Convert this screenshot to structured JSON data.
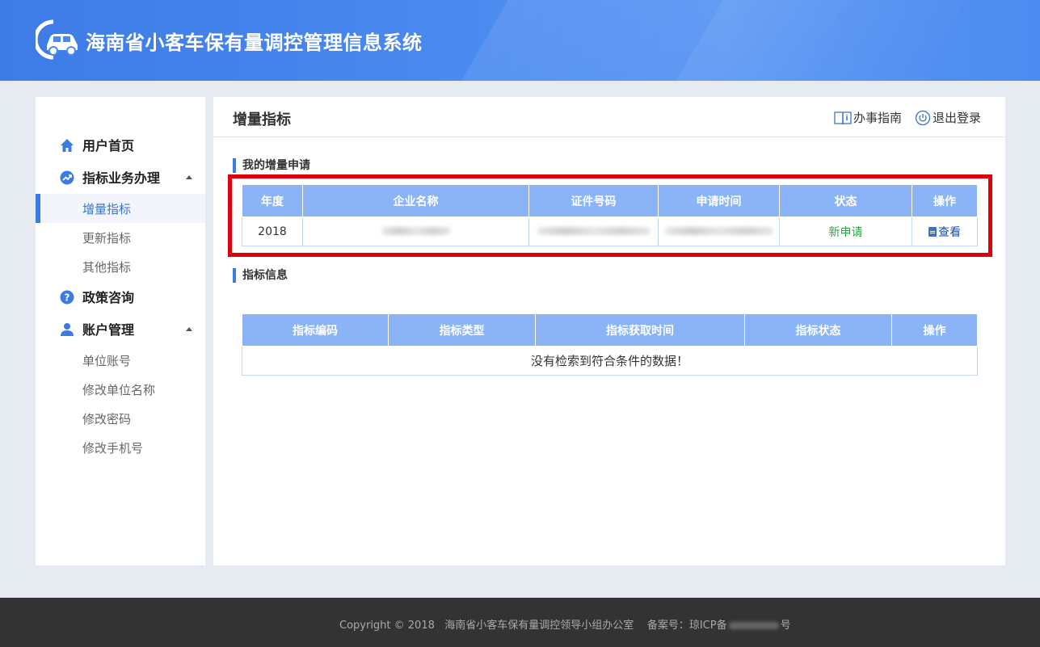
{
  "header": {
    "title": "海南省小客车保有量调控管理信息系统",
    "logo_icon": "car-logo-icon"
  },
  "sidebar": {
    "groups": [
      {
        "label": "用户首页",
        "icon": "home-icon"
      },
      {
        "label": "指标业务办理",
        "icon": "trend-icon"
      },
      {
        "label": "政策咨询",
        "icon": "question-icon"
      },
      {
        "label": "账户管理",
        "icon": "user-icon"
      }
    ],
    "sub_business": [
      "增量指标",
      "更新指标",
      "其他指标"
    ],
    "sub_account": [
      "单位账号",
      "修改单位名称",
      "修改密码",
      "修改手机号"
    ]
  },
  "main": {
    "page_title": "增量指标",
    "guide_link": "办事指南",
    "logout_link": "退出登录",
    "section1_title": "我的增量申请",
    "table1": {
      "headers": [
        "年度",
        "企业名称",
        "证件号码",
        "申请时间",
        "状态",
        "操作"
      ],
      "rows": [
        {
          "year": "2018",
          "status": "新申请",
          "action": "查看"
        }
      ]
    },
    "section2_title": "指标信息",
    "table2": {
      "headers": [
        "指标编码",
        "指标类型",
        "指标获取时间",
        "指标状态",
        "操作"
      ],
      "empty_message": "没有检索到符合条件的数据！"
    }
  },
  "footer": {
    "copyright": "Copyright © 2018",
    "org": "海南省小客车保有量调控领导小组办公室",
    "icp_prefix": "备案号：琼ICP备",
    "icp_suffix": "号"
  },
  "colors": {
    "accent": "#3b7be4",
    "table_header": "#8bb4f7",
    "status_green": "#28a745",
    "highlight_red": "#e0000c"
  }
}
